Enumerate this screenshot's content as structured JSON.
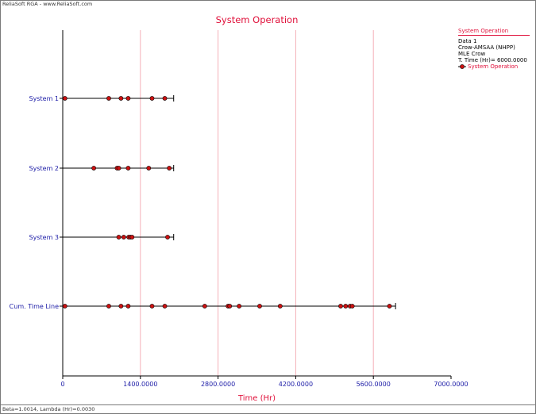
{
  "header": {
    "app_caption": "ReliaSoft RGA - www.ReliaSoft.com"
  },
  "legend": {
    "title": "System Operation",
    "lines": [
      "Data 1",
      "Crow-AMSAA (NHPP)",
      "MLE Crow",
      "T. Time (Hr)= 6000.0000"
    ],
    "series_label": "System Operation"
  },
  "footer": {
    "text": "Beta=1.0014, Lambda (Hr)=0.0030"
  },
  "colors": {
    "accent": "#e0103a",
    "axis_text": "#1a1aa6",
    "point_fill": "#cc1111",
    "grid": "#f4b0b8"
  },
  "chart_data": {
    "type": "scatter",
    "title": "System Operation",
    "xlabel": "Time (Hr)",
    "ylabel": "",
    "xlim": [
      0,
      7000
    ],
    "x_ticks": [
      "0",
      "1400.0000",
      "2800.0000",
      "4200.0000",
      "5600.0000",
      "7000.0000"
    ],
    "x_tick_values": [
      0,
      1400,
      2800,
      4200,
      5600,
      7000
    ],
    "grid": "vertical",
    "legend_position": "top-right",
    "categories": [
      "System 1",
      "System 2",
      "System 3",
      "Cum. Time Line"
    ],
    "series": [
      {
        "name": "System 1",
        "end": 2000,
        "x": [
          40,
          830,
          1050,
          1180,
          1610,
          1840
        ]
      },
      {
        "name": "System 2",
        "end": 2000,
        "x": [
          560,
          980,
          1010,
          1180,
          1550,
          1920
        ]
      },
      {
        "name": "System 3",
        "end": 2000,
        "x": [
          1010,
          1100,
          1190,
          1220,
          1250,
          1890
        ]
      },
      {
        "name": "Cum. Time Line",
        "end": 6000,
        "x": [
          40,
          830,
          1050,
          1180,
          1610,
          1840,
          2560,
          2980,
          3010,
          3180,
          3550,
          3920,
          5010,
          5100,
          5180,
          5220,
          5890
        ]
      }
    ]
  }
}
